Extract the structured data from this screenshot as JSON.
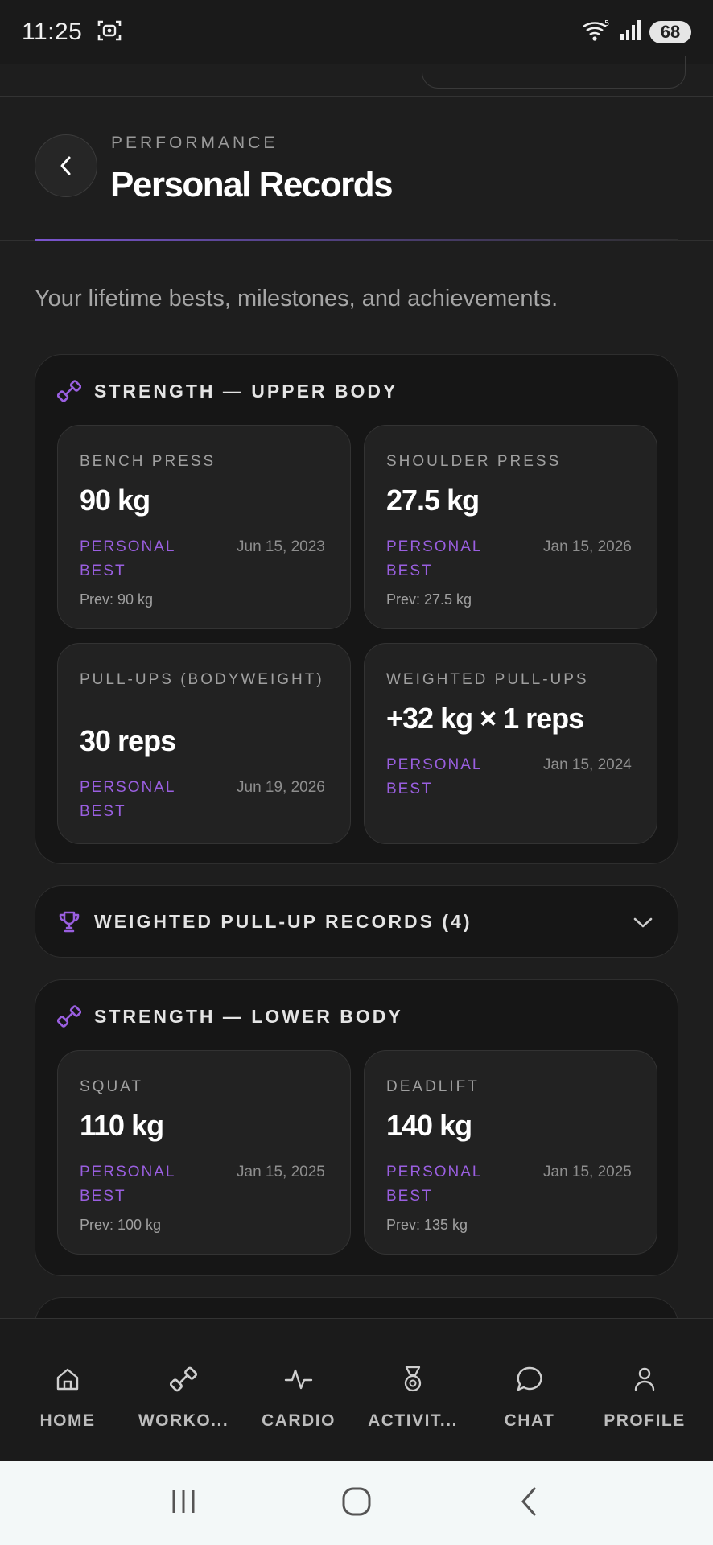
{
  "status_bar": {
    "time": "11:25",
    "battery": "68"
  },
  "header": {
    "eyebrow": "PERFORMANCE",
    "title": "Personal Records"
  },
  "subtitle": "Your lifetime bests, milestones, and achievements.",
  "upper_body": {
    "title": "STRENGTH — UPPER BODY",
    "cards": [
      {
        "label": "BENCH PRESS",
        "value": "90 kg",
        "badge": "PERSONAL BEST",
        "date": "Jun 15, 2023",
        "prev": "Prev: 90 kg"
      },
      {
        "label": "SHOULDER PRESS",
        "value": "27.5 kg",
        "badge": "PERSONAL BEST",
        "date": "Jan 15, 2026",
        "prev": "Prev: 27.5 kg"
      },
      {
        "label": "PULL-UPS (BODYWEIGHT)",
        "value": "30 reps",
        "badge": "PERSONAL BEST",
        "date": "Jun 19, 2026"
      },
      {
        "label": "WEIGHTED PULL-UPS",
        "value": "+32 kg × 1 reps",
        "badge": "PERSONAL BEST",
        "date": "Jan 15, 2024"
      }
    ]
  },
  "weighted_records": {
    "title": "WEIGHTED PULL-UP RECORDS (4)"
  },
  "lower_body": {
    "title": "STRENGTH — LOWER BODY",
    "cards": [
      {
        "label": "SQUAT",
        "value": "110 kg",
        "badge": "PERSONAL BEST",
        "date": "Jan 15, 2025",
        "prev": "Prev: 100 kg"
      },
      {
        "label": "DEADLIFT",
        "value": "140 kg",
        "badge": "PERSONAL BEST",
        "date": "Jan 15, 2025",
        "prev": "Prev: 135 kg"
      }
    ]
  },
  "bottom_nav": [
    {
      "label": "HOME",
      "icon": "home-icon"
    },
    {
      "label": "WORKO...",
      "icon": "dumbbell-icon"
    },
    {
      "label": "CARDIO",
      "icon": "pulse-icon"
    },
    {
      "label": "ACTIVIT...",
      "icon": "medal-icon"
    },
    {
      "label": "CHAT",
      "icon": "chat-icon"
    },
    {
      "label": "PROFILE",
      "icon": "user-icon"
    }
  ],
  "colors": {
    "accent": "#9a5fe0",
    "background": "#1e1e1e",
    "card": "#222222"
  }
}
